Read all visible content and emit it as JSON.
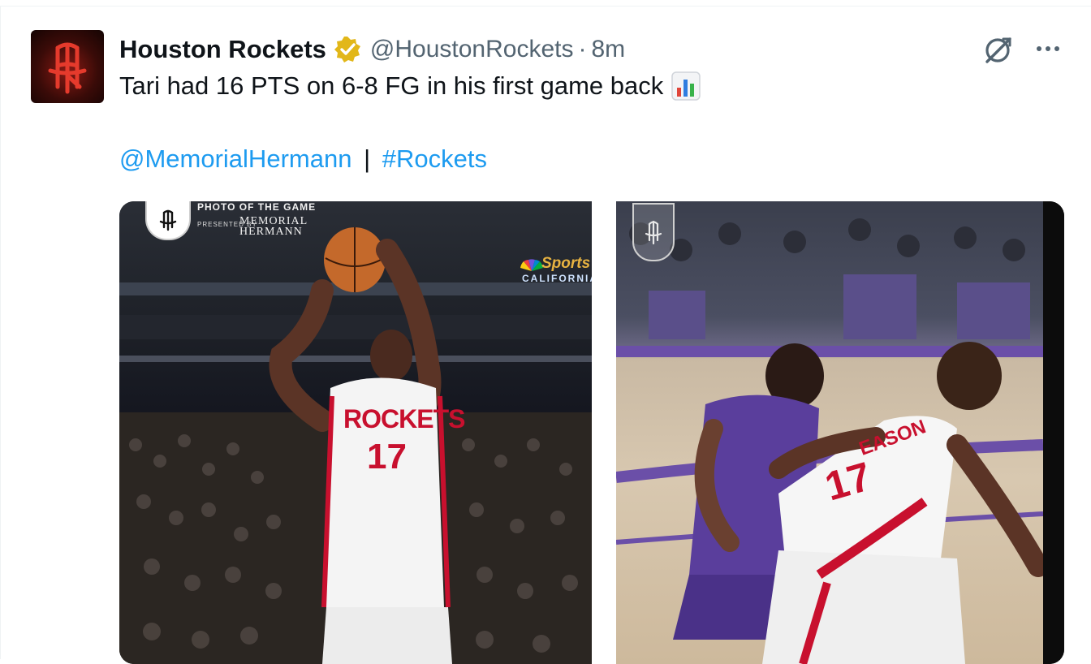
{
  "tweet": {
    "display_name": "Houston Rockets",
    "handle": "@HoustonRockets",
    "separator": "·",
    "time": "8m",
    "text": "Tari had 16 PTS on 6-8 FG in his first game back",
    "emoji_icon": "bar-chart-emoji",
    "mention": "@MemorialHermann",
    "pipe": "|",
    "hashtag": "#Rockets"
  },
  "icons": {
    "verified": "verified-badge-icon",
    "grok": "grok-icon",
    "more": "more-icon"
  },
  "colors": {
    "link": "#1d9bf0",
    "text": "#0f1419",
    "secondary": "#536471",
    "verified_gold": "#e2b719",
    "rockets_red": "#c8102e"
  },
  "media": {
    "left_photo": {
      "header_title": "PHOTO OF THE GAME",
      "presented_by": "PRESENTED BY",
      "sponsor_line1": "MEMORIAL",
      "sponsor_line2": "HERMANN",
      "arena_sign_top": "Sports",
      "arena_sign_bottom": "CALIFORNIA",
      "jersey_text": "ROCKETS",
      "jersey_number": "17"
    },
    "right_photo": {
      "jersey_name": "EASON",
      "jersey_number": "17"
    }
  }
}
